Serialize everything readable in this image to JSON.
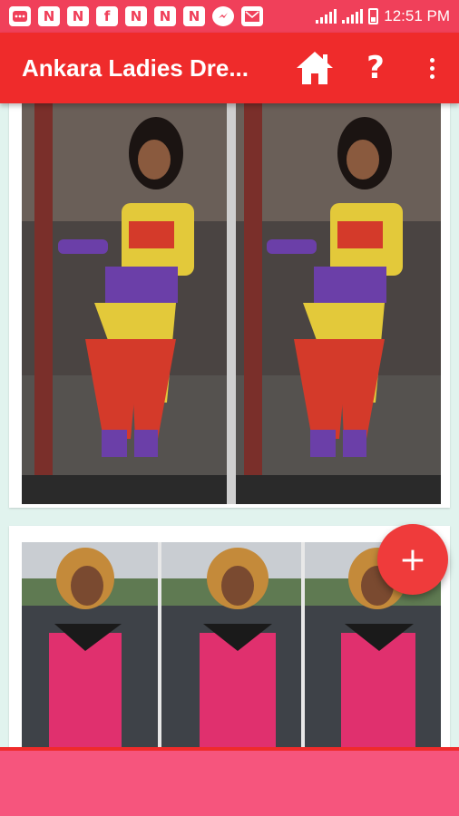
{
  "status_bar": {
    "time": "12:51 PM",
    "notification_icons": [
      "N",
      "N",
      "f",
      "N",
      "N",
      "N"
    ],
    "icon_names": [
      "chat-icon",
      "n-app-icon",
      "n-app-icon",
      "facebook-icon",
      "n-app-icon",
      "n-app-icon",
      "n-app-icon",
      "messenger-icon",
      "mail-icon"
    ]
  },
  "app_bar": {
    "title": "Ankara Ladies Dre...",
    "help_label": "?",
    "background": "#ef2b2b"
  },
  "fab": {
    "label": "+"
  },
  "colors": {
    "accent": "#ef2b2b",
    "status_bar": "#f0405a",
    "content_bg": "#e1f3ee",
    "banner": "#f6557d"
  }
}
